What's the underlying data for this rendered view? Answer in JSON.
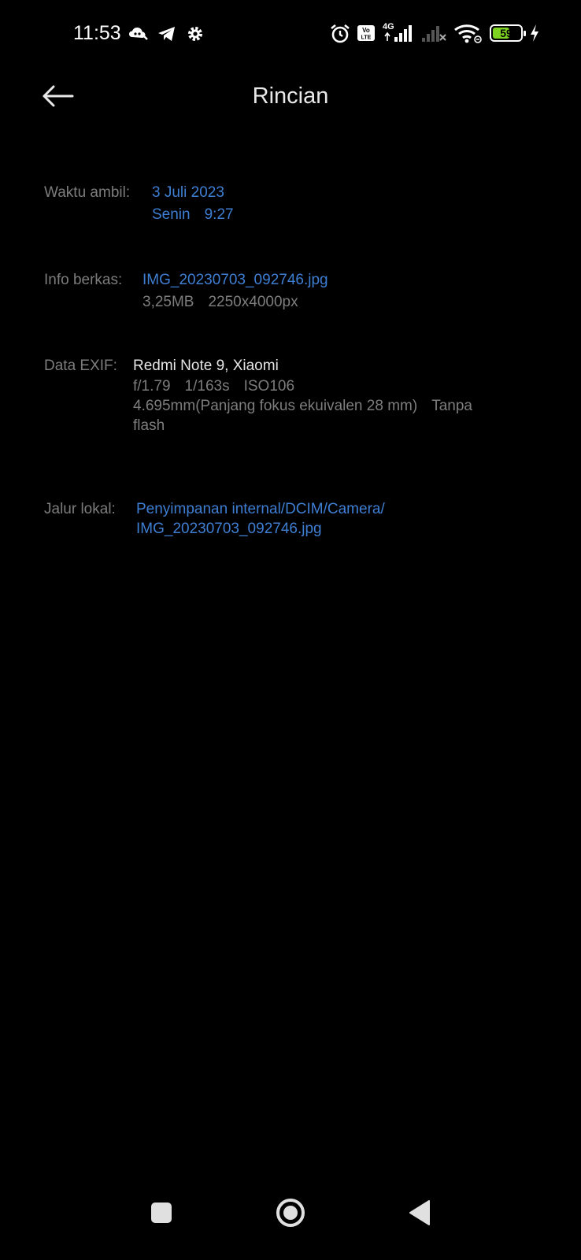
{
  "status_bar": {
    "time": "11:53",
    "battery_percent": "59",
    "battery_color": "#7ed321",
    "network_label": "4G",
    "volte_label": "Vo LTE",
    "left_icons": [
      "cloud-game-icon",
      "telegram-icon",
      "settings-gear-icon"
    ],
    "right_icons": [
      "alarm-icon",
      "volte-icon",
      "signal-4g-icon",
      "signal-no-service-icon",
      "wifi-icon",
      "battery-icon",
      "charging-bolt-icon"
    ]
  },
  "header": {
    "title": "Rincian",
    "back_icon": "arrow-left-icon"
  },
  "details": {
    "waktu": {
      "label": "Waktu ambil:",
      "date": "3 Juli 2023",
      "day": "Senin",
      "time": "9:27"
    },
    "info": {
      "label": "Info berkas:",
      "filename": "IMG_20230703_092746.jpg",
      "size": "3,25MB",
      "resolution": "2250x4000px"
    },
    "exif": {
      "label": "Data EXIF:",
      "device": "Redmi Note 9, Xiaomi",
      "aperture": "f/1.79",
      "shutter": "1/163s",
      "iso": "ISO106",
      "focal_line1": "4.695mm(Panjang fokus ekuivalen 28 mm)",
      "flash_a": "Tanpa",
      "flash_b": "flash"
    },
    "path": {
      "label": "Jalur lokal:",
      "line1": "Penyimpanan internal/DCIM/Camera/",
      "line2": "IMG_20230703_092746.jpg"
    }
  },
  "colors": {
    "link_blue": "#3e7fd3",
    "label_gray": "#7d7d7d",
    "background": "#000000"
  },
  "navbar": {
    "icons": [
      "recents-square-icon",
      "home-circle-icon",
      "back-triangle-icon"
    ]
  }
}
